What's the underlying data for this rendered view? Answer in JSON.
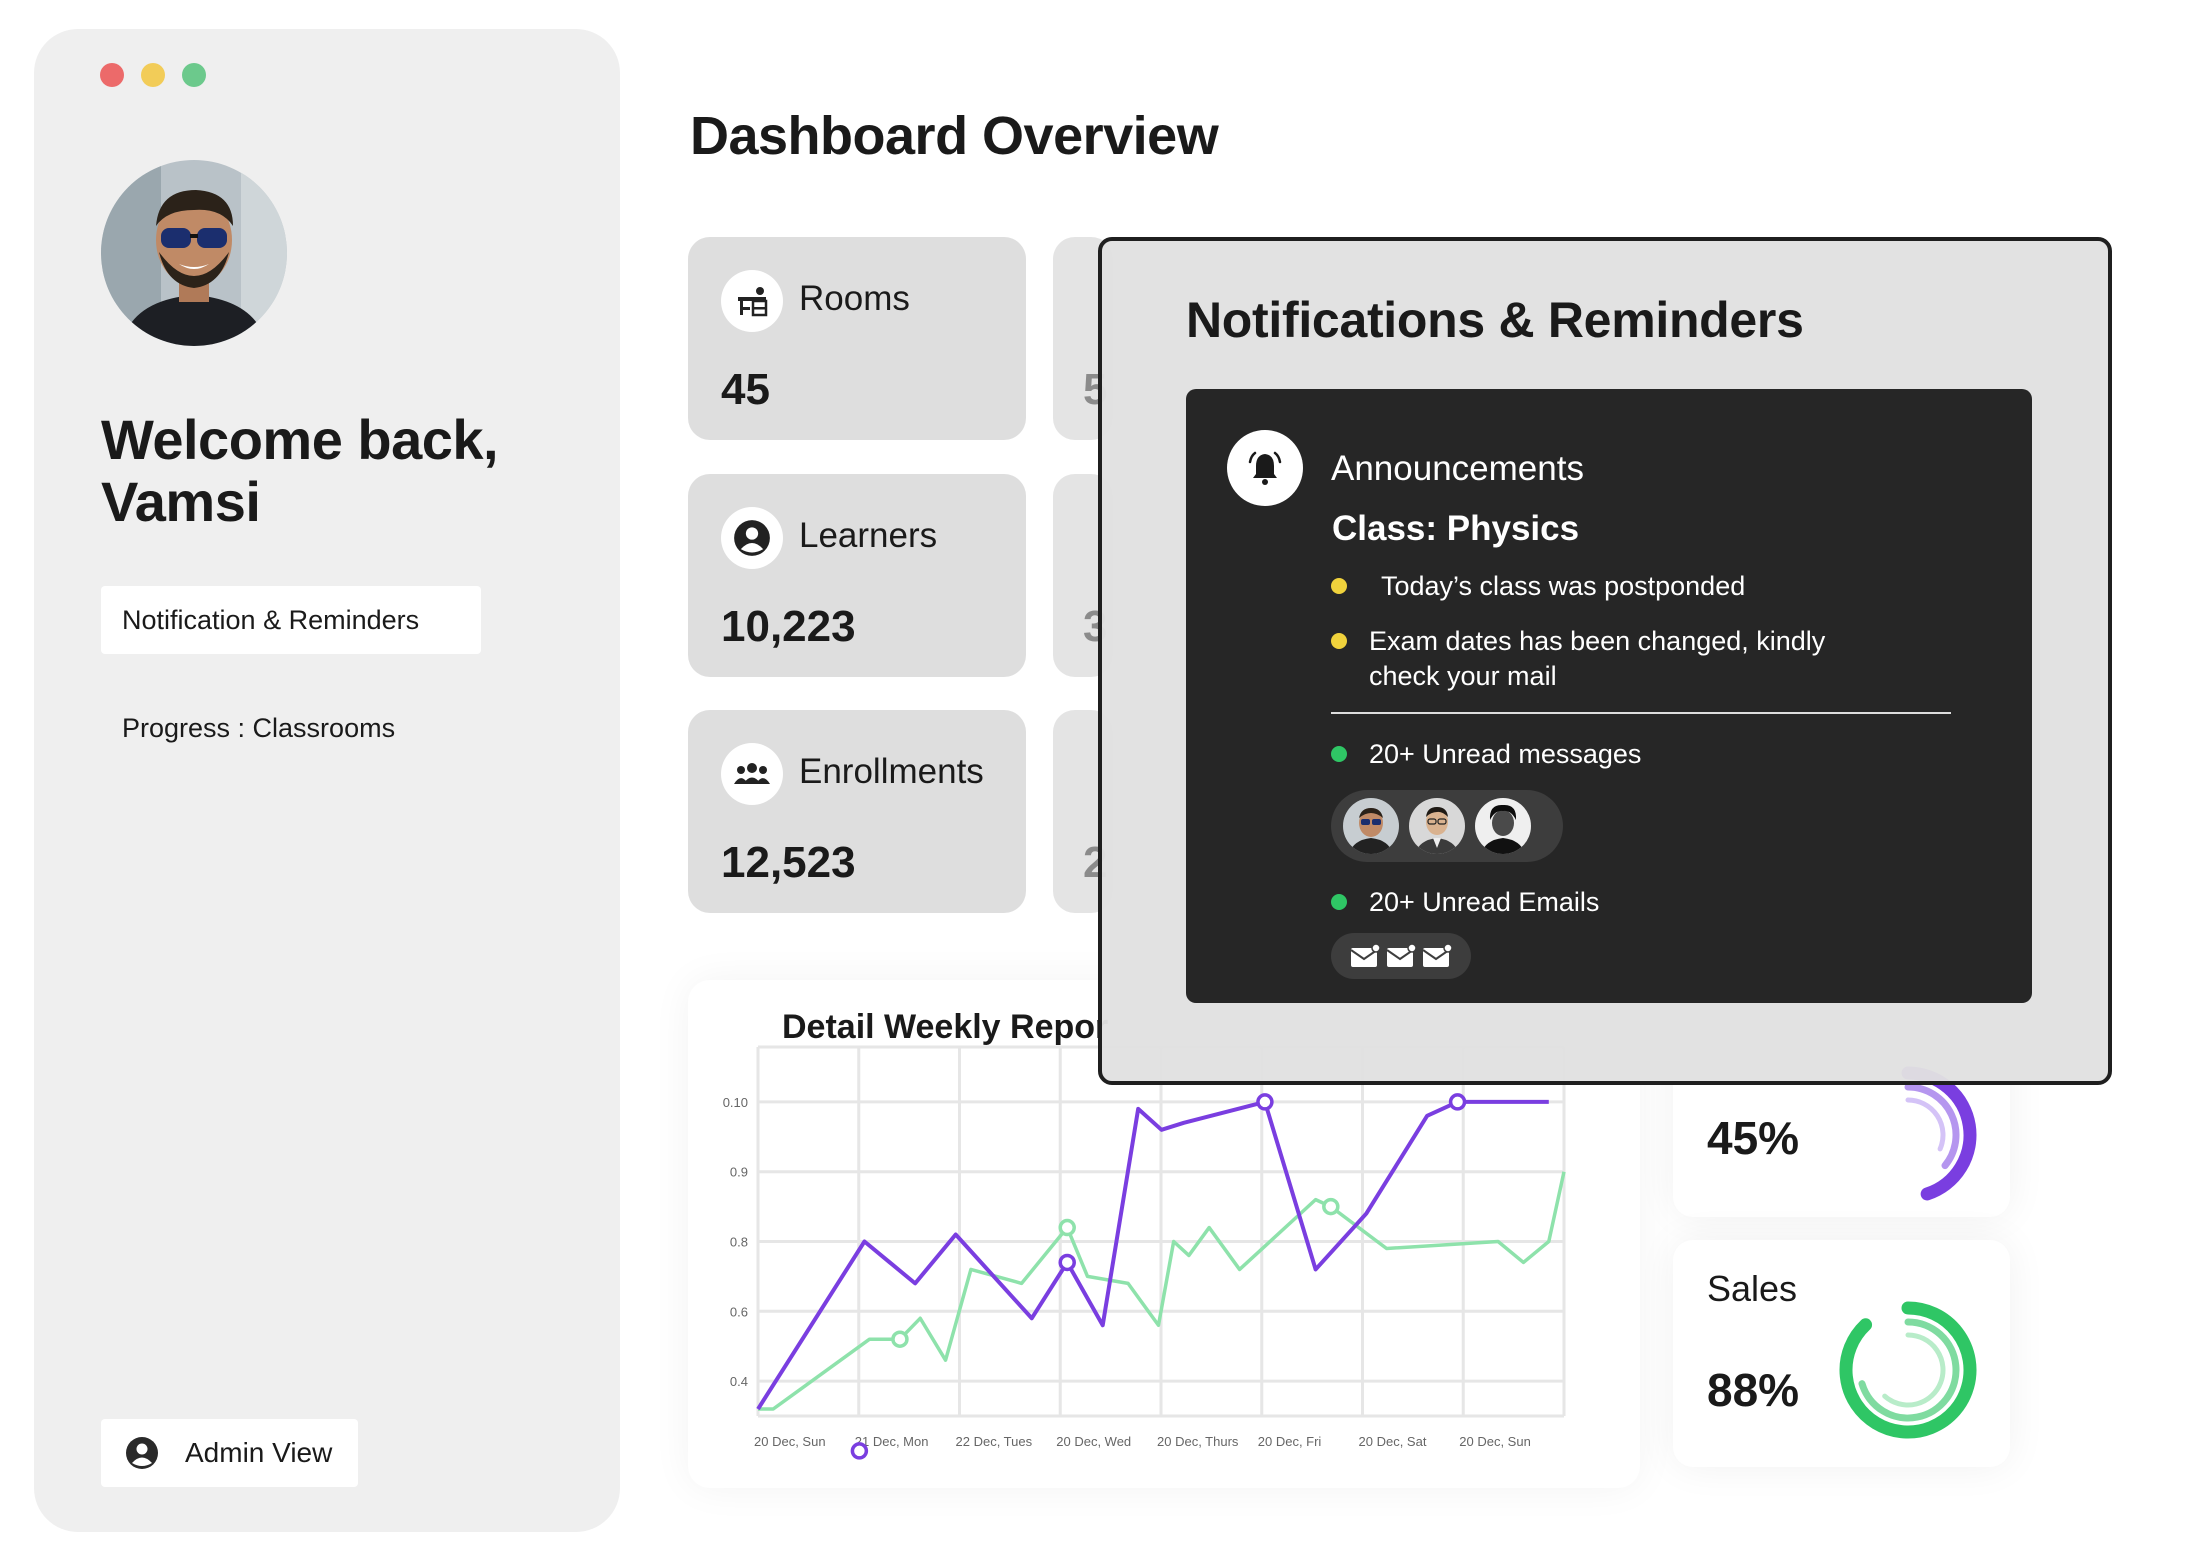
{
  "window": {
    "dots": [
      "#ec6a6a",
      "#f2cc58",
      "#6cc98c"
    ]
  },
  "sidebar": {
    "welcome_line1": "Welcome back,",
    "welcome_line2": "Vamsi",
    "nav": [
      {
        "label": "Notification & Reminders",
        "active": true
      },
      {
        "label": "Progress : Classrooms",
        "active": false
      }
    ],
    "admin_label": "Admin View"
  },
  "main": {
    "title": "Dashboard Overview",
    "cards": [
      {
        "label": "Rooms",
        "value": "45",
        "icon": "desk-icon"
      },
      {
        "label": "Learners",
        "value": "10,223",
        "icon": "user-circle-icon"
      },
      {
        "label": "Enrollments",
        "value": "12,523",
        "icon": "group-icon"
      }
    ],
    "ghost_cards": [
      "5",
      "3",
      "2"
    ]
  },
  "chart_data": {
    "type": "line",
    "title": "Detail Weekly Repor",
    "categories": [
      "20 Dec, Sun",
      "21 Dec, Mon",
      "22 Dec, Tues",
      "20 Dec, Wed",
      "20 Dec, Thurs",
      "20 Dec, Fri",
      "20 Dec, Sat",
      "20 Dec, Sun"
    ],
    "y_ticks": [
      "0.10",
      "0.9",
      "0.8",
      "0.6",
      "0.4"
    ],
    "y_tick_positions": [
      5,
      4,
      3,
      2,
      1
    ],
    "ylim": [
      0.5,
      5.5
    ],
    "series": [
      {
        "color": "#7a3ee0",
        "x": [
          0,
          1.05,
          1.55,
          1.95,
          2.7,
          3.05,
          3.4,
          3.75,
          3.98,
          4.2,
          5.0,
          5.5,
          6.0,
          6.6,
          6.9,
          7.0,
          7.8
        ],
        "y": [
          0.6,
          3.0,
          2.4,
          3.1,
          1.9,
          2.7,
          1.8,
          4.9,
          4.6,
          4.7,
          5.0,
          2.6,
          3.4,
          4.8,
          5.0,
          5.0,
          5.0
        ],
        "markers": [
          1,
          3.05,
          5.0,
          6.9
        ]
      },
      {
        "color": "#8ee2ab",
        "x": [
          0,
          0.15,
          1.1,
          1.4,
          1.6,
          1.85,
          2.1,
          2.6,
          3.05,
          3.25,
          3.65,
          3.95,
          4.1,
          4.25,
          4.45,
          4.75,
          5.5,
          5.65,
          6.2,
          7.3,
          7.55,
          7.8,
          7.95
        ],
        "y": [
          0.6,
          0.6,
          1.6,
          1.6,
          1.9,
          1.3,
          2.6,
          2.4,
          3.2,
          2.5,
          2.4,
          1.8,
          3.0,
          2.8,
          3.2,
          2.6,
          3.6,
          3.5,
          2.9,
          3.0,
          2.7,
          3.0,
          4.0
        ],
        "markers": [
          1.4,
          3.05,
          5.65
        ]
      }
    ]
  },
  "stats": [
    {
      "name": "",
      "percent": "45%",
      "value": 0.45,
      "color": "#7a3ee0"
    },
    {
      "name": "Sales",
      "percent": "88%",
      "value": 0.88,
      "color": "#2fc665"
    }
  ],
  "notifications": {
    "title": "Notifications & Reminders",
    "announcement_title": "Announcements",
    "class_name": "Class: Physics",
    "announcements": [
      "Today’s class was postponded",
      "Exam dates has been changed, kindly\ncheck your mail"
    ],
    "unread_messages": "20+ Unread messages",
    "unread_emails": "20+ Unread Emails",
    "announcement_dot_color": "#f0d23c",
    "unread_dot_color": "#2fc665"
  }
}
